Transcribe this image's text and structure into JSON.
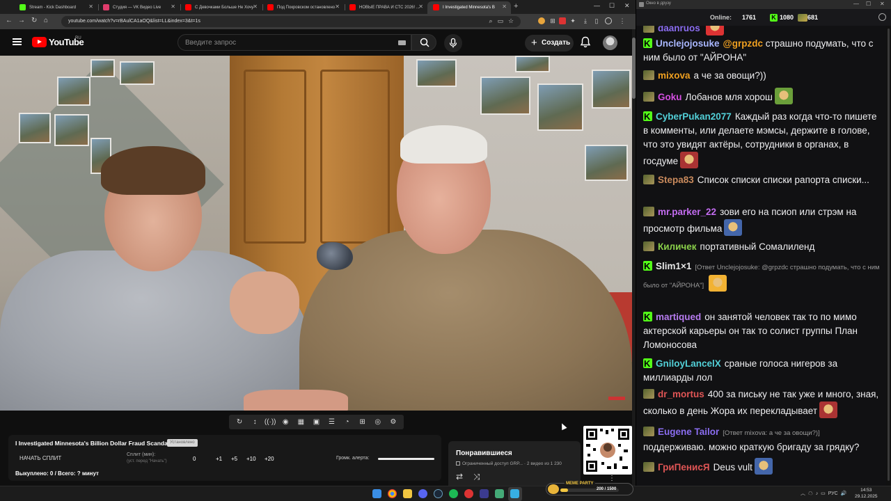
{
  "browser": {
    "tabs": [
      {
        "title": "Stream - Kick Dashboard",
        "favicon_color": "#53fc18"
      },
      {
        "title": "Студия — VK Видео Live",
        "favicon_color": "#e03c6c"
      },
      {
        "title": "С Девочками Больше Не Хочу",
        "favicon_color": "#ff0000"
      },
      {
        "title": "Под Покровском остановлено",
        "favicon_color": "#ff0000"
      },
      {
        "title": "НОВЫЕ ПРАВА И СТС 2026! ...",
        "favicon_color": "#ff0000"
      },
      {
        "title": "I Investigated Minnesota's B",
        "favicon_color": "#ff0000"
      }
    ],
    "url": "youtube.com/watch?v=rBAulCA1aOQ&list=LL&index=3&t=1s"
  },
  "youtube": {
    "logo_text": "YouTube",
    "region": "RU",
    "search_placeholder": "Введите запрос",
    "create_label": "Создать"
  },
  "ext_toolbar": {
    "icons": [
      "↻",
      "↕",
      "((·))",
      "◉",
      "▦",
      "▣",
      "☰",
      "◔",
      "⊞",
      "◎",
      "⚙"
    ],
    "icon_names": [
      "loop-icon",
      "sort-icon",
      "broadcast-icon",
      "eye-icon",
      "calendar-icon",
      "frame-icon",
      "film-icon",
      "speed-icon",
      "add-clip-icon",
      "screenshot-icon",
      "settings-icon"
    ]
  },
  "split_panel": {
    "title": "I Investigated Minnesota's Billion Dollar Fraud Scandal",
    "badge": "Установлено",
    "start_label": "НАЧАТЬ СПЛИТ",
    "split_label": "Сплит (мин):",
    "split_hint": "(уст. перед \"Начать\")",
    "values": [
      "0",
      "+1",
      "+5",
      "+10",
      "+20"
    ],
    "alert_label": "Громк. алерта:",
    "alert_volume": 1.0,
    "sold_out": "Выкуплено: 0 / Всего: ? минут"
  },
  "playlist": {
    "title": "Понравившиеся",
    "subtitle": "Ограниченный доступ GRP... · 2 видео из 1 230"
  },
  "chat": {
    "window_title": "Окно в друзу",
    "online_label": "Online:",
    "online_count": "1761",
    "kick_count": "1080",
    "twitch_count": "681",
    "messages": [
      {
        "platform": "t",
        "user": "daanruos",
        "color": "#8b6df0",
        "text": "",
        "emote": true
      },
      {
        "platform": "k",
        "user": "Unclejojosuke",
        "color": "#a9b7ff",
        "mention": "@grpzdc",
        "text": "страшно подумать, что с ним было от \"АЙРОНА\""
      },
      {
        "platform": "t",
        "user": "mixova",
        "color": "#f0a020",
        "text": "а че за овощи?))"
      },
      {
        "platform": "t",
        "user": "Goku",
        "color": "#d44fe0",
        "text": "Лобанов мля хорош",
        "emote": true
      },
      {
        "platform": "k",
        "user": "CyberPukan2077",
        "color": "#52d0d8",
        "text": "Каждый раз когда что-то пишете в комменты, или делаете мэмсы, держите в голове, что это увидят актёры, сотрудники в органах, в госдуме",
        "emote": true
      },
      {
        "platform": "t",
        "user": "Stepa83",
        "color": "#c98a5c",
        "text": "Список списки списки рапорта списки..."
      },
      {
        "platform": "t",
        "user": "mr.parker_22",
        "color": "#c36cf0",
        "text": "зови его на псиоп или стрэм на просмотр фильма",
        "emote": true
      },
      {
        "platform": "t",
        "user": "Киличек",
        "color": "#8ad04a",
        "text": "портативный Сомалиленд"
      },
      {
        "platform": "k",
        "user": "Slim1×1",
        "color": "#e8e8e8",
        "reply": "[Ответ Unclejojosuke: @grpzdc страшно подумать, что с ним было от \"АЙРОНА\"]",
        "text": "",
        "emote": true
      },
      {
        "platform": "k",
        "user": "martiqued",
        "color": "#b77cf0",
        "text": "он занятой человек так то по мимо актерской карьеры он так то солист группы План Ломоносова"
      },
      {
        "platform": "k",
        "user": "GniloyLancelX",
        "color": "#52d0d8",
        "text": "сраные голоса нигеров за миллиарды лол"
      },
      {
        "platform": "t",
        "user": "dr_mortus",
        "color": "#e05555",
        "text": "400 за письку не так уже и много, зная, сколько в день Жора их перекладывает",
        "emote": true
      },
      {
        "platform": "t",
        "user": "Eugene Tailor",
        "color": "#8a6df0",
        "reply": "[Ответ mixova: а че за овощи?)]",
        "text": "поддерживаю. можно краткую бригаду за грядку?"
      },
      {
        "platform": "t",
        "user": "ГриПенисЯ",
        "color": "#e05555",
        "text": "Deus vult",
        "emote": true
      }
    ]
  },
  "taskbar": {
    "meme_title": "MEME PARTY",
    "meme_value": "200 / 1500",
    "meme_progress": 0.13,
    "lang": "РУС",
    "time": "14:53",
    "date": "29.12.2025"
  }
}
